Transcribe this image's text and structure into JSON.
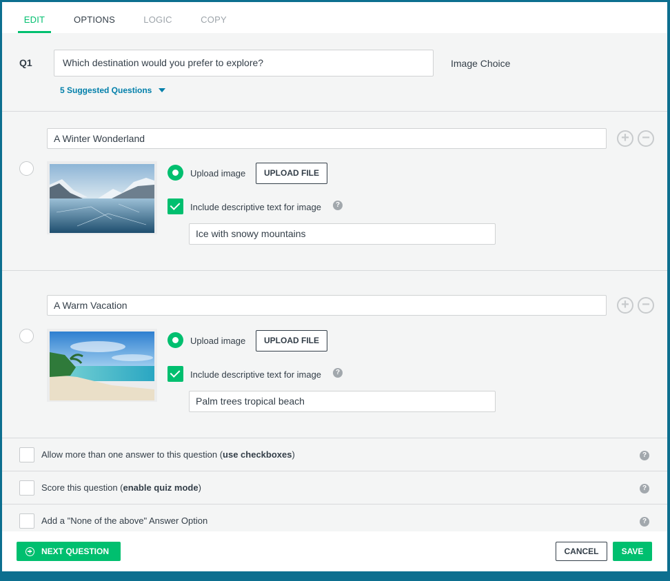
{
  "tabs": [
    {
      "label": "EDIT",
      "state": "active"
    },
    {
      "label": "OPTIONS",
      "state": "normal"
    },
    {
      "label": "LOGIC",
      "state": "disabled"
    },
    {
      "label": "COPY",
      "state": "disabled"
    }
  ],
  "question": {
    "number": "Q1",
    "text": "Which destination would you prefer to explore?",
    "type": "Image Choice",
    "suggested_label": "5 Suggested Questions"
  },
  "answers": [
    {
      "label": "A Winter Wonderland",
      "image": "winter-lake-mountains",
      "upload_label": "Upload image",
      "upload_button": "UPLOAD FILE",
      "include_text_label": "Include descriptive text for image",
      "include_text_checked": true,
      "description": "Ice with snowy mountains"
    },
    {
      "label": "A Warm Vacation",
      "image": "tropical-beach",
      "upload_label": "Upload image",
      "upload_button": "UPLOAD FILE",
      "include_text_label": "Include descriptive text for image",
      "include_text_checked": true,
      "description": "Palm trees tropical beach"
    }
  ],
  "options": [
    {
      "prefix": "Allow more than one answer to this question (",
      "bold": "use checkboxes",
      "suffix": ")",
      "checked": false
    },
    {
      "prefix": "Score this question (",
      "bold": "enable quiz mode",
      "suffix": ")",
      "checked": false
    },
    {
      "prefix": "Add a \"None of the above\" Answer Option",
      "bold": "",
      "suffix": "",
      "checked": false
    }
  ],
  "footer": {
    "next_label": "NEXT QUESTION",
    "cancel_label": "CANCEL",
    "save_label": "SAVE"
  },
  "colors": {
    "accent": "#00bf6f",
    "link": "#007faa",
    "frame": "#0d6f8f"
  }
}
